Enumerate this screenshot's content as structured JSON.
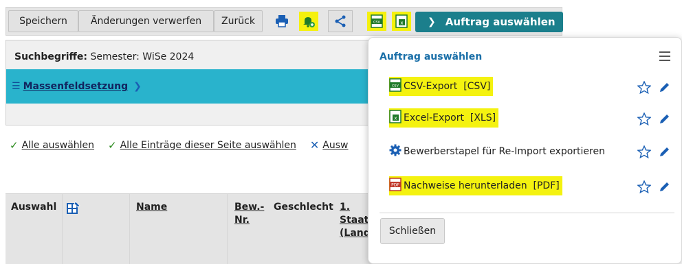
{
  "toolbar": {
    "save_label": "Speichern",
    "discard_label": "Änderungen verwerfen",
    "back_label": "Zurück",
    "select_order_label": "Auftrag auswählen"
  },
  "search": {
    "label": "Suchbegriffe:",
    "value": "Semester: WiSe 2024"
  },
  "mass_edit": {
    "label": "Massenfeldsetzung"
  },
  "selection_links": {
    "select_all": "Alle auswählen",
    "select_page": "Alle Einträge dieser Seite auswählen",
    "deselect": "Ausw"
  },
  "table": {
    "headers": {
      "auswahl": "Auswahl",
      "name": "Name",
      "bew_nr_1": "Bew.-",
      "bew_nr_2": "Nr.",
      "geschlecht": "Geschlecht",
      "staat_1": "1.",
      "staat_2": "Staat",
      "staat_3": "(Land"
    }
  },
  "popup": {
    "title": "Auftrag auswählen",
    "items": [
      {
        "label": "CSV-Export  [CSV]",
        "icon": "csv-icon",
        "highlighted": true
      },
      {
        "label": "Excel-Export  [XLS]",
        "icon": "excel-icon",
        "highlighted": true
      },
      {
        "label": "Bewerberstapel für Re-Import exportieren",
        "icon": "gear-icon",
        "highlighted": false
      },
      {
        "label": "Nachweise herunterladen  [PDF]",
        "icon": "pdf-icon",
        "highlighted": true
      }
    ],
    "close_label": "Schließen"
  },
  "colors": {
    "accent": "#1b7f8c",
    "mass_bar": "#29b3cc",
    "highlight": "#f4f210",
    "link_blue": "#1a6fa8"
  }
}
